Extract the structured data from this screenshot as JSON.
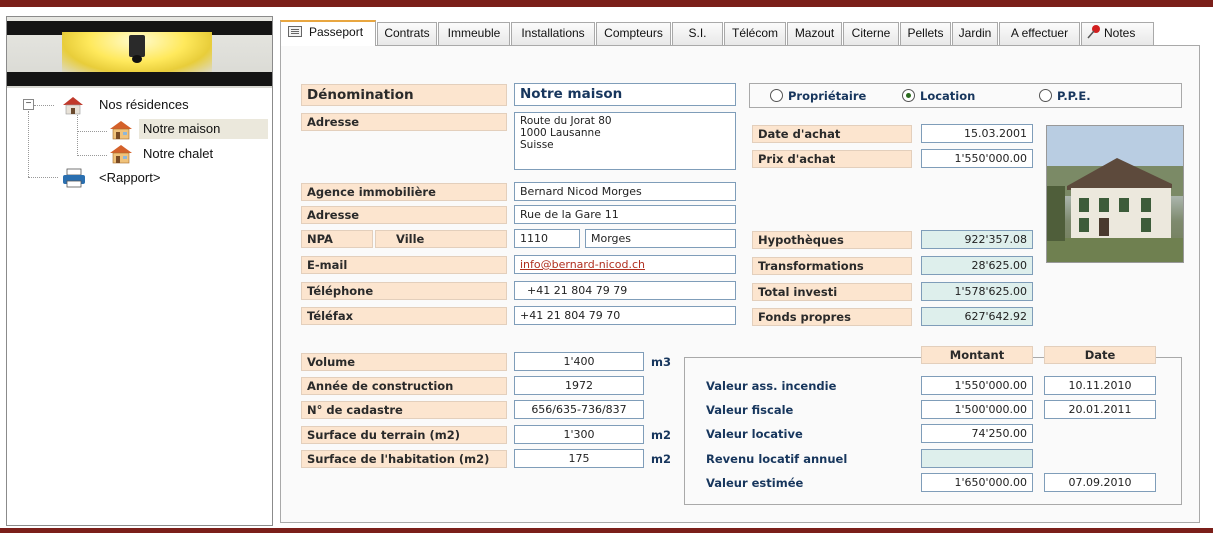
{
  "tree": {
    "root_label": "Nos résidences",
    "items": [
      "Notre maison",
      "Notre chalet"
    ],
    "report_label": "<Rapport>"
  },
  "tabs": [
    "Passeport",
    "Contrats",
    "Immeuble",
    "Installations",
    "Compteurs",
    "S.I.",
    "Télécom",
    "Mazout",
    "Citerne",
    "Pellets",
    "Jardin",
    "A effectuer",
    "Notes"
  ],
  "form": {
    "denomination_label": "Dénomination",
    "denomination_value": "Notre maison",
    "adresse_label": "Adresse",
    "adresse_value": "Route du Jorat 80\n1000 Lausanne\nSuisse",
    "agence_label": "Agence immobilière",
    "agence_value": "Bernard Nicod Morges",
    "agence_adresse_label": "Adresse",
    "agence_adresse_value": "Rue de la Gare 11",
    "npa_label": "NPA",
    "ville_label": "Ville",
    "npa_value": "1110",
    "ville_value": "Morges",
    "email_label": "E-mail",
    "email_value": "info@bernard-nicod.ch",
    "telephone_label": "Téléphone",
    "telephone_value": "+41 21 804 79 79",
    "telefax_label": "Téléfax",
    "telefax_value": "+41 21 804 79 70",
    "volume_label": "Volume",
    "volume_value": "1'400",
    "volume_unit": "m3",
    "annee_label": "Année de construction",
    "annee_value": "1972",
    "cadastre_label": "N° de cadastre",
    "cadastre_value": "656/635-736/837",
    "terrain_label": "Surface du terrain (m2)",
    "terrain_value": "1'300",
    "terrain_unit": "m2",
    "habitation_label": "Surface de l'habitation (m2)",
    "habitation_value": "175",
    "habitation_unit": "m2"
  },
  "ownership": {
    "options": [
      "Propriétaire",
      "Location",
      "P.P.E."
    ],
    "selected": "Location"
  },
  "purchase": {
    "date_label": "Date d'achat",
    "date_value": "15.03.2001",
    "prix_label": "Prix d'achat",
    "prix_value": "1'550'000.00"
  },
  "finance": {
    "hypotheques_label": "Hypothèques",
    "hypotheques_value": "922'357.08",
    "transformations_label": "Transformations",
    "transformations_value": "28'625.00",
    "total_label": "Total investi",
    "total_value": "1'578'625.00",
    "fonds_label": "Fonds propres",
    "fonds_value": "627'642.92"
  },
  "valuation": {
    "montant_header": "Montant",
    "date_header": "Date",
    "rows": [
      {
        "label": "Valeur ass. incendie",
        "montant": "1'550'000.00",
        "date": "10.11.2010"
      },
      {
        "label": "Valeur fiscale",
        "montant": "1'500'000.00",
        "date": "20.01.2011"
      },
      {
        "label": "Valeur locative",
        "montant": "74'250.00",
        "date": ""
      },
      {
        "label": "Revenu locatif annuel",
        "montant": "",
        "date": ""
      },
      {
        "label": "Valeur estimée",
        "montant": "1'650'000.00",
        "date": "07.09.2010"
      }
    ]
  },
  "colors": {
    "accent_bar": "#7b1f1a",
    "label_bg": "#fce5cf",
    "teal_field": "#deefec",
    "value_text": "#17365d"
  }
}
